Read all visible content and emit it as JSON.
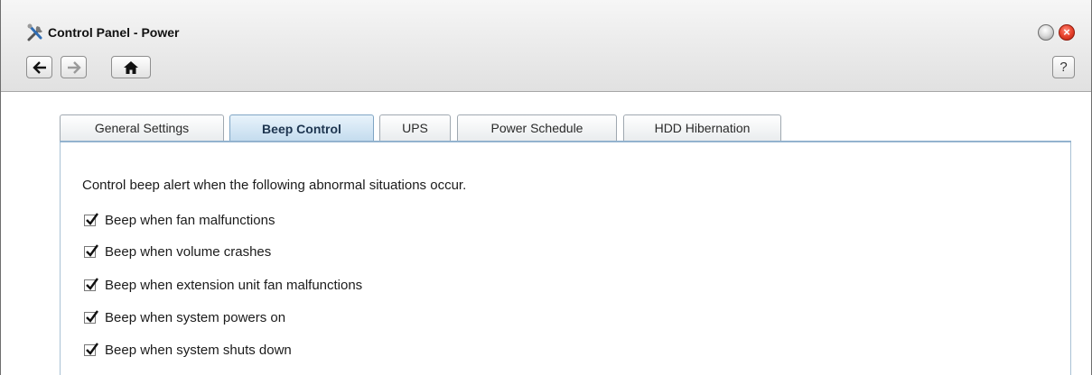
{
  "window": {
    "title": "Control Panel - Power",
    "app_icon": "tools-icon",
    "help_label": "?"
  },
  "toolbar": {
    "back_icon": "arrow-left-icon",
    "forward_icon": "arrow-right-icon",
    "home_icon": "home-icon"
  },
  "tabs": [
    {
      "label": "General Settings",
      "active": false
    },
    {
      "label": "Beep Control",
      "active": true
    },
    {
      "label": "UPS",
      "active": false
    },
    {
      "label": "Power Schedule",
      "active": false
    },
    {
      "label": "HDD Hibernation",
      "active": false
    }
  ],
  "beep_control": {
    "description": "Control beep alert when the following abnormal situations occur.",
    "options": [
      {
        "label": "Beep when fan malfunctions",
        "checked": true
      },
      {
        "label": "Beep when volume crashes",
        "checked": true
      },
      {
        "label": "Beep when extension unit fan malfunctions",
        "checked": true
      },
      {
        "label": "Beep when system powers on",
        "checked": true
      },
      {
        "label": "Beep when system shuts down",
        "checked": true
      }
    ]
  },
  "colors": {
    "active_tab": "#c3dbee",
    "close_button": "#e8432d"
  }
}
